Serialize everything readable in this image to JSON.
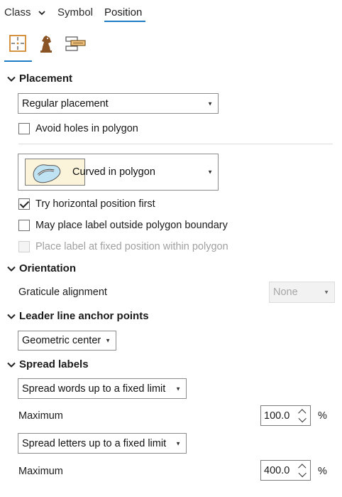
{
  "tabs": {
    "class": "Class",
    "symbol": "Symbol",
    "position": "Position"
  },
  "toolbar_icons": [
    "position-crosshair-icon",
    "chess-knight-icon",
    "label-stack-icon"
  ],
  "colors": {
    "accent": "#1e7cc4",
    "icon_orange": "#d2872f"
  },
  "placement": {
    "title": "Placement",
    "placement_value": "Regular placement",
    "avoid_holes_label": "Avoid holes in polygon",
    "avoid_holes_checked": false,
    "style_value": "Curved in polygon",
    "try_horizontal_label": "Try horizontal position first",
    "try_horizontal_checked": true,
    "outside_boundary_label": "May place label outside polygon boundary",
    "outside_boundary_checked": false,
    "fixed_position_label": "Place label at fixed position within polygon",
    "fixed_position_checked": false
  },
  "orientation": {
    "title": "Orientation",
    "graticule_label": "Graticule alignment",
    "graticule_value": "None"
  },
  "leader": {
    "title": "Leader line anchor points",
    "anchor_value": "Geometric center"
  },
  "spread": {
    "title": "Spread labels",
    "words_value": "Spread words up to a fixed limit",
    "words_max_label": "Maximum",
    "words_max_value": "100.0",
    "words_unit": "%",
    "letters_value": "Spread letters up to a fixed limit",
    "letters_max_label": "Maximum",
    "letters_max_value": "400.0",
    "letters_unit": "%"
  }
}
